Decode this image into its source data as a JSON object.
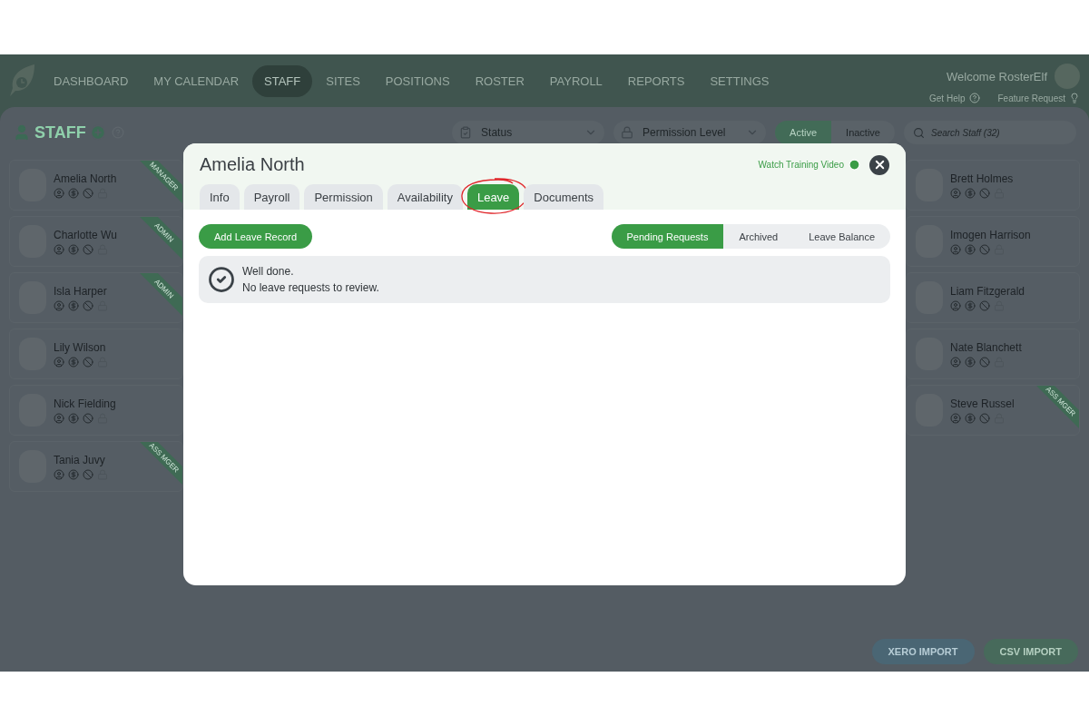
{
  "nav": {
    "items": [
      {
        "label": "DASHBOARD",
        "selected": false
      },
      {
        "label": "MY CALENDAR",
        "selected": false
      },
      {
        "label": "STAFF",
        "selected": true
      },
      {
        "label": "SITES",
        "selected": false
      },
      {
        "label": "POSITIONS",
        "selected": false
      },
      {
        "label": "ROSTER",
        "selected": false
      },
      {
        "label": "PAYROLL",
        "selected": false
      },
      {
        "label": "REPORTS",
        "selected": false
      },
      {
        "label": "SETTINGS",
        "selected": false
      }
    ],
    "welcome": "Welcome RosterElf",
    "links": [
      {
        "label": "Get Help",
        "kind": "help"
      },
      {
        "label": "Feature Request",
        "kind": "idea"
      }
    ]
  },
  "staff_page": {
    "title": "STAFF",
    "filters": [
      {
        "kind": "status",
        "label": "Status"
      },
      {
        "kind": "permission",
        "label": "Permission Level"
      }
    ],
    "status_toggle": [
      {
        "label": "Active",
        "selected": true
      },
      {
        "label": "Inactive",
        "selected": false
      }
    ],
    "search": {
      "placeholder": "Search Staff (32)"
    },
    "staff_left": [
      {
        "name": "Amelia North",
        "ribbon": "MANAGER"
      },
      {
        "name": "Charlotte Wu",
        "ribbon": "ADMIN"
      },
      {
        "name": "Isla Harper",
        "ribbon": "ADMIN"
      },
      {
        "name": "Lily Wilson"
      },
      {
        "name": "Nick Fielding"
      },
      {
        "name": "Tania Juvy",
        "ribbon": "ASS MGER"
      }
    ],
    "staff_right": [
      {
        "name": "Brett Holmes"
      },
      {
        "name": "Imogen Harrison"
      },
      {
        "name": "Liam Fitzgerald"
      },
      {
        "name": "Nate Blanchett"
      },
      {
        "name": "Steve Russel",
        "ribbon": "ASS MGER"
      }
    ],
    "import_buttons": [
      {
        "label": "XERO IMPORT",
        "kind": "xero"
      },
      {
        "label": "CSV IMPORT",
        "kind": "csv"
      }
    ]
  },
  "modal": {
    "title": "Amelia North",
    "training_link": "Watch Training Video",
    "tabs": [
      {
        "label": "Info",
        "selected": false
      },
      {
        "label": "Payroll",
        "selected": false
      },
      {
        "label": "Permission",
        "selected": false
      },
      {
        "label": "Availability",
        "selected": false
      },
      {
        "label": "Leave",
        "selected": true,
        "circled": true
      },
      {
        "label": "Documents",
        "selected": false
      }
    ],
    "add_button": "Add Leave Record",
    "views": [
      {
        "label": "Pending Requests",
        "selected": true
      },
      {
        "label": "Archived",
        "selected": false
      },
      {
        "label": "Leave Balance",
        "selected": false
      }
    ],
    "message": {
      "title": "Well done.",
      "text": "No leave requests to review."
    }
  }
}
